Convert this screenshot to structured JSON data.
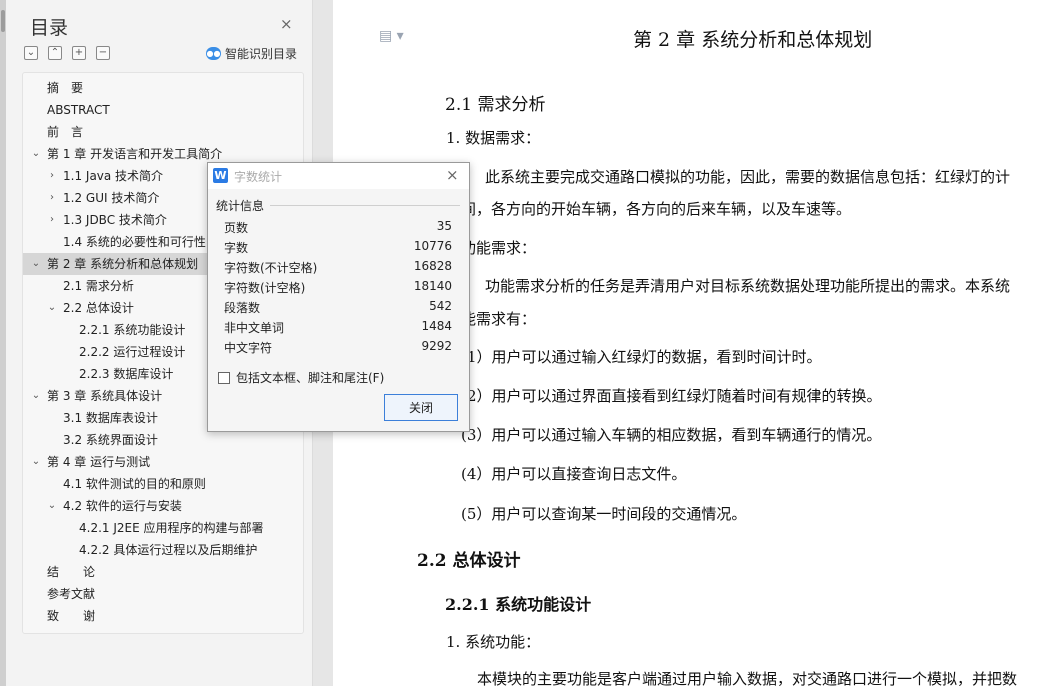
{
  "nav": {
    "title": "目录",
    "close_icon": "×",
    "tools": [
      "⌄",
      "⌃",
      "+",
      "−"
    ],
    "smart_label": "智能识别目录",
    "toc": [
      {
        "label": "摘　要",
        "level": 0,
        "arrow": ""
      },
      {
        "label": "ABSTRACT",
        "level": 0,
        "arrow": ""
      },
      {
        "label": "前　言",
        "level": 0,
        "arrow": ""
      },
      {
        "label": "第 1 章  开发语言和开发工具简介",
        "level": 0,
        "arrow": "⌄"
      },
      {
        "label": "1.1  Java 技术简介",
        "level": 1,
        "arrow": "›"
      },
      {
        "label": "1.2  GUI 技术简介",
        "level": 1,
        "arrow": "›"
      },
      {
        "label": "1.3  JDBC 技术简介",
        "level": 1,
        "arrow": "›"
      },
      {
        "label": "1.4  系统的必要性和可行性",
        "level": 1,
        "arrow": ""
      },
      {
        "label": "第 2 章  系统分析和总体规划",
        "level": 0,
        "arrow": "⌄",
        "active": true
      },
      {
        "label": "2.1  需求分析",
        "level": 1,
        "arrow": ""
      },
      {
        "label": "2.2  总体设计",
        "level": 1,
        "arrow": "⌄"
      },
      {
        "label": "2.2.1  系统功能设计",
        "level": 2,
        "arrow": ""
      },
      {
        "label": "2.2.2  运行过程设计",
        "level": 2,
        "arrow": ""
      },
      {
        "label": "2.2.3  数据库设计",
        "level": 2,
        "arrow": ""
      },
      {
        "label": "第 3 章  系统具体设计",
        "level": 0,
        "arrow": "⌄"
      },
      {
        "label": "3.1  数据库表设计",
        "level": 1,
        "arrow": ""
      },
      {
        "label": "3.2  系统界面设计",
        "level": 1,
        "arrow": ""
      },
      {
        "label": "第 4 章  运行与测试",
        "level": 0,
        "arrow": "⌄"
      },
      {
        "label": "4.1  软件测试的目的和原则",
        "level": 1,
        "arrow": ""
      },
      {
        "label": "4.2  软件的运行与安装",
        "level": 1,
        "arrow": "⌄"
      },
      {
        "label": "4.2.1  J2EE 应用程序的构建与部署",
        "level": 2,
        "arrow": ""
      },
      {
        "label": "4.2.2  具体运行过程以及后期维护",
        "level": 2,
        "arrow": ""
      },
      {
        "label": "结　　论",
        "level": 0,
        "arrow": ""
      },
      {
        "label": "参考文献",
        "level": 0,
        "arrow": ""
      },
      {
        "label": "致　　谢",
        "level": 0,
        "arrow": ""
      }
    ]
  },
  "doc": {
    "chapter_title": "第 2 章  系统分析和总体规划",
    "sec_2_1": "2.1 需求分析",
    "item_1": "1.  数据需求：",
    "para_1a": "此系统主要完成交通路口模拟的功能，因此，需要的数据信息包括：红绿灯的计",
    "para_1b": "间，各方向的开始车辆，各方向的后来车辆，以及车速等。",
    "item_2": "功能需求：",
    "para_2a": "功能需求分析的任务是弄清用户对目标系统数据处理功能所提出的需求。本系统",
    "para_2b": "能需求有：",
    "req_1": "1）用户可以通过输入红绿灯的数据，看到时间计时。",
    "req_2": "2）用户可以通过界面直接看到红绿灯随着时间有规律的转换。",
    "req_3": "(3）用户可以通过输入车辆的相应数据，看到车辆通行的情况。",
    "req_4": "(4）用户可以直接查询日志文件。",
    "req_5": "(5）用户可以查询某一时间段的交通情况。",
    "sec_2_2": "2.2 总体设计",
    "sec_2_2_1": "2.2.1 系统功能设计",
    "item_3": "1.  系统功能：",
    "para_3": "本模块的主要功能是客户端通过用户输入数据，对交通路口进行一个模拟，并把数"
  },
  "dialog": {
    "icon_letter": "W",
    "title": "字数统计",
    "close_icon": "×",
    "group_label": "统计信息",
    "stats": [
      {
        "label": "页数",
        "value": "35"
      },
      {
        "label": "字数",
        "value": "10776"
      },
      {
        "label": "字符数(不计空格)",
        "value": "16828"
      },
      {
        "label": "字符数(计空格)",
        "value": "18140"
      },
      {
        "label": "段落数",
        "value": "542"
      },
      {
        "label": "非中文单词",
        "value": "1484"
      },
      {
        "label": "中文字符",
        "value": "9292"
      }
    ],
    "checkbox_label": "包括文本框、脚注和尾注(F)",
    "checkbox_checked": false,
    "close_button": "关闭"
  }
}
